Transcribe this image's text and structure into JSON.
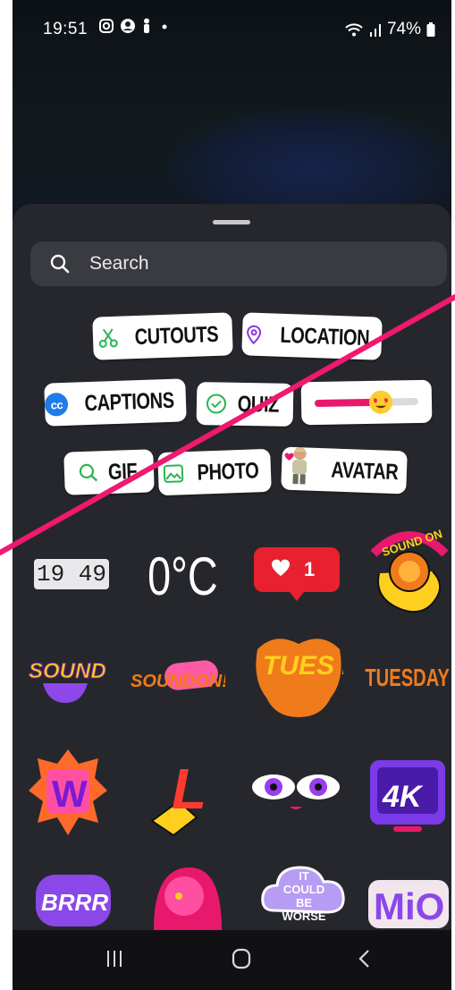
{
  "status": {
    "time": "19:51",
    "battery": "74%"
  },
  "search": {
    "placeholder": "Search"
  },
  "chips": {
    "cutouts": "CUTOUTS",
    "location": "LOCATION",
    "captions": "CAPTIONS",
    "quiz": "QUIZ",
    "gif": "GIF",
    "photo": "PHOTO",
    "avatar": "AVATAR",
    "captions_badge": "cc"
  },
  "stickers": {
    "clock": "19 49",
    "temperature": "0°C",
    "like_count": "1",
    "sound_on": "SOUND ON",
    "sound_sticker": "SOUND",
    "sound_on_script": "SOUNDON!",
    "tues_day": "TUES DAY",
    "tuesday": "TUESDAY",
    "w_letter": "W",
    "l_letter": "L",
    "four_k": "4K",
    "brrr": "BRRR",
    "could_be_worse": "IT COULD BE WORSE",
    "mio": "MiO"
  },
  "colors": {
    "accent_line": "#f0186f",
    "sheet": "#26272c",
    "like_red": "#e8202f"
  },
  "icons": {
    "nav_left": "recent-apps-icon",
    "nav_center": "home-icon",
    "nav_right": "back-icon"
  }
}
